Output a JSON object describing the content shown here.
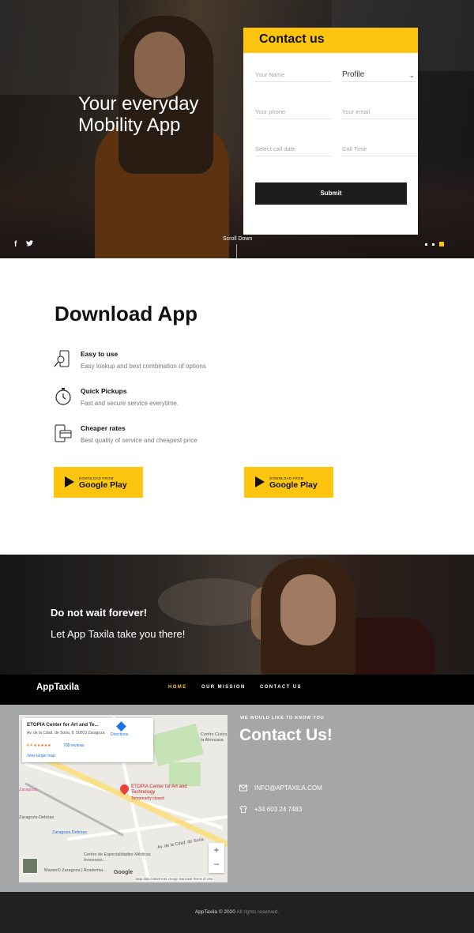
{
  "hero": {
    "title_line1": "Your everyday",
    "title_line2": "Mobility App",
    "scroll_label": "Scroll Down",
    "social": [
      "f",
      "t"
    ]
  },
  "contact_form": {
    "heading": "Contact us",
    "name_placeholder": "Your Name",
    "profile_value": "Profile",
    "phone_placeholder": "Your phone",
    "email_placeholder": "Your email",
    "date_placeholder": "Select call date",
    "time_placeholder": "Call Time",
    "submit_label": "Submit"
  },
  "download": {
    "title": "Download App",
    "features": [
      {
        "title": "Easy to use",
        "desc": "Easy lookup and best combination of options",
        "icon": "phone-search-icon"
      },
      {
        "title": "Quick Pickups",
        "desc": "Fast and secure service everytime.",
        "icon": "stopwatch-icon"
      },
      {
        "title": "Cheaper rates",
        "desc": "Best quality of service and cheapest price",
        "icon": "phone-card-icon"
      }
    ],
    "store_button_small": "DOWNLOAD FROM",
    "store_button_big": "Google Play"
  },
  "banner": {
    "line1": "Do not wait forever!",
    "line2": "Let App Taxila take you there!"
  },
  "nav": {
    "brand": "AppTaxila",
    "links": [
      "HOME",
      "OUR MISSION",
      "CONTACT US"
    ]
  },
  "contact_section": {
    "kicker": "WE WOULD LIKE TO KNOW YOU",
    "title": "Contact Us!",
    "email": "INFO@APTAXILA.COM",
    "phone": "+34 603 24 7483"
  },
  "map": {
    "place_name": "ETOPIA Center for Art and Te...",
    "address": "Av. de la Cdad. de Soria, 8, 50003 Zaragoza",
    "rating": "4.4 ★★★★★",
    "reviews": "708 reviews",
    "directions": "Directions",
    "larger_map": "View larger map",
    "pin_label": "ETOPIA Center for Art and Technology",
    "pin_sub": "Temporarily closed",
    "labels": {
      "zaragoza": "Zaragoza",
      "delicias_area": "Zaragoza-Delicias",
      "delicias_station": "Zaragoza Delicias",
      "centro": "Centro de Especialidades Médicas Inocencio...",
      "avenida": "Av. de la Cdad. de Soria",
      "colegio": "MasterD Zaragoza | Academia...",
      "centro_civico": "Centro Cívico la Almozara"
    },
    "attribution": "Map data ©2020 Inst. Geogr. Nacional   Terms of Use",
    "google": "Google"
  },
  "footer": {
    "brand": "AppTaxila © 2020",
    "rights": "All rights reserved."
  },
  "colors": {
    "accent": "#fdc50f",
    "dark": "#1c1c1c",
    "section_grey": "#a4a6a8"
  }
}
